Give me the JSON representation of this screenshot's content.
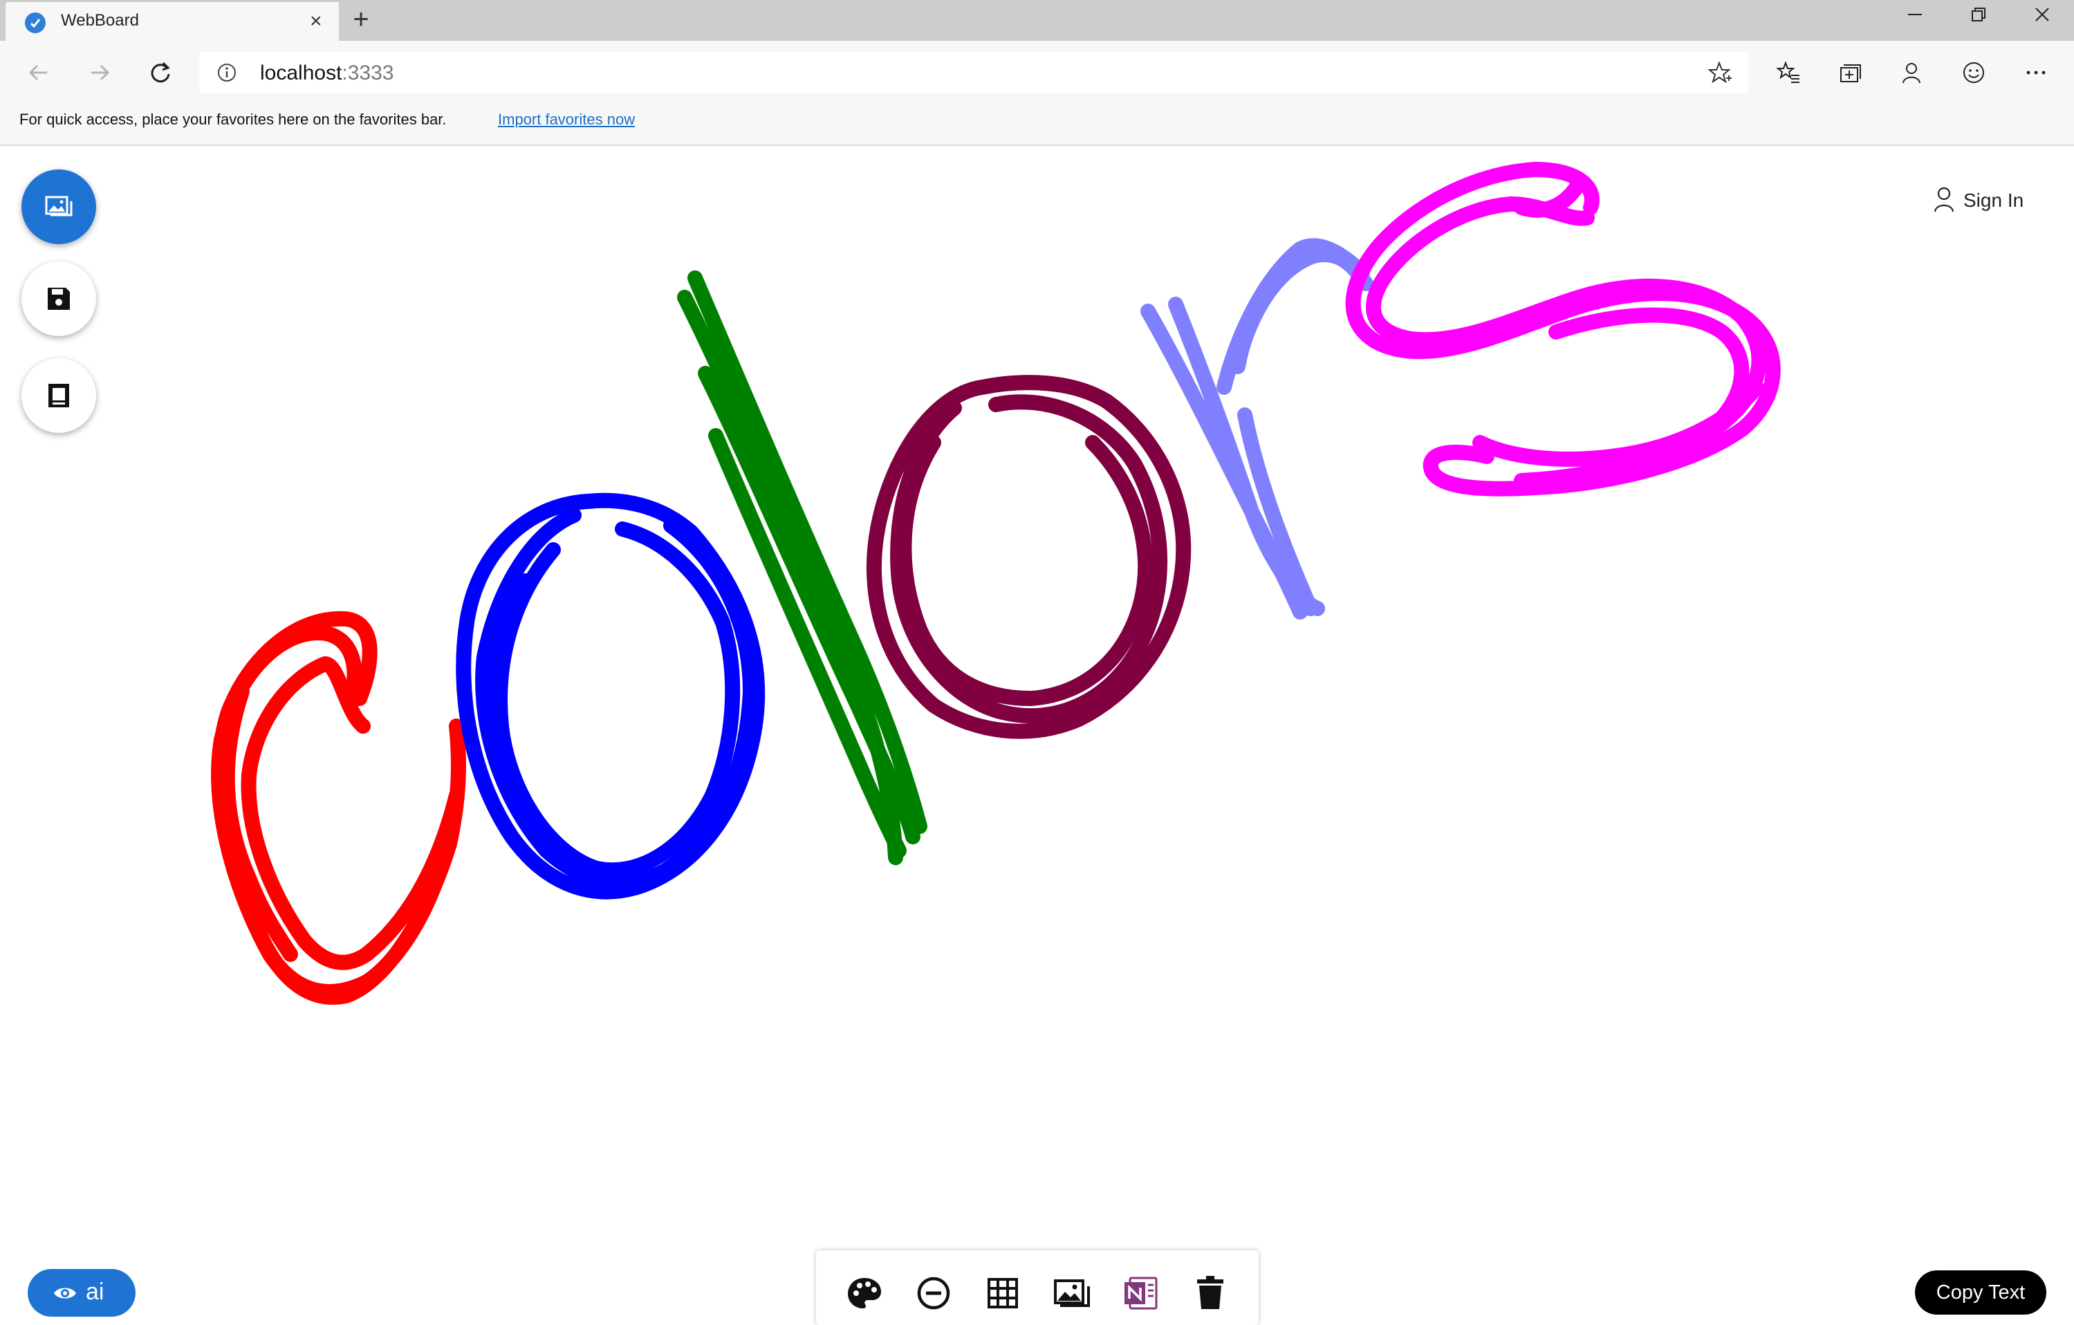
{
  "browser": {
    "tab_title": "WebBoard",
    "tab_close_label": "×",
    "new_tab_label": "+",
    "url_host": "localhost",
    "url_port": ":3333"
  },
  "favorites_bar": {
    "message": "For quick access, place your favorites here on the favorites bar.",
    "import_link": "Import favorites now"
  },
  "app": {
    "sign_in_label": "Sign In",
    "ai_label": "ai",
    "copy_text_label": "Copy Text",
    "left_actions": [
      "gallery-icon",
      "save-icon",
      "notebook-icon"
    ],
    "bottom_tools": [
      "palette-icon",
      "eraser-icon",
      "grid-icon",
      "image-icon",
      "onenote-icon",
      "trash-icon"
    ],
    "accent_color": "#1f74d3"
  },
  "drawing": {
    "strokes": [
      {
        "letter": "c",
        "color": "#ff0000"
      },
      {
        "letter": "o",
        "color": "#0000ff"
      },
      {
        "letter": "l",
        "color": "#008000"
      },
      {
        "letter": "o",
        "color": "#800040"
      },
      {
        "letter": "r",
        "color": "#8080ff"
      },
      {
        "letter": "s",
        "color": "#ff00ff"
      }
    ]
  }
}
